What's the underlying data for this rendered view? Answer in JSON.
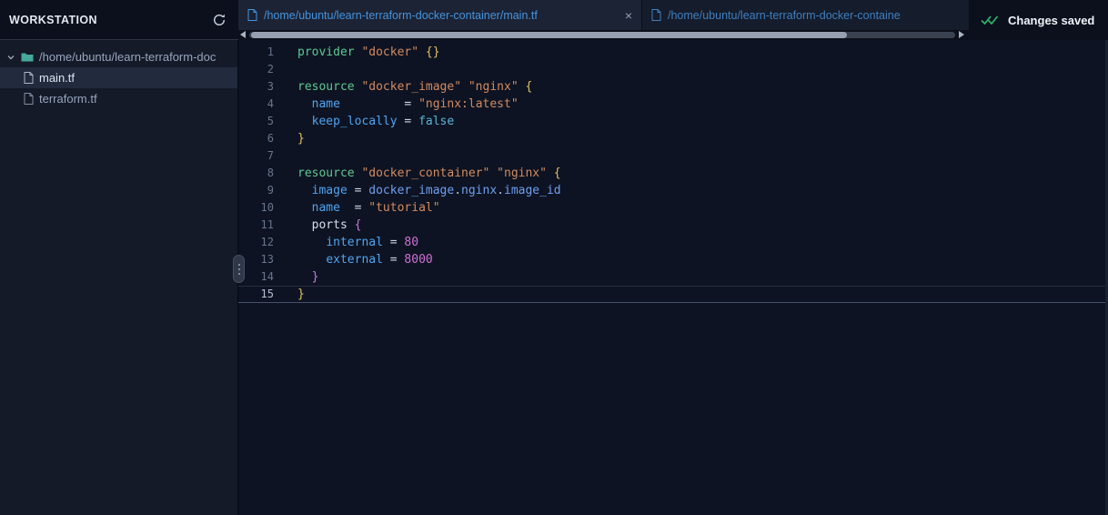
{
  "colors": {
    "topbar": "#0b101c",
    "sidebar": "#141a28",
    "editorBg": "#0d1322",
    "tabActive": "#1c2334",
    "tabTextActive": "#4593dd",
    "treeText": "#96a5bd",
    "success": "#2fb36b",
    "kw": "#5fc892",
    "str": "#d28a60",
    "brace": "#e2c06a",
    "prop": "#4fa4f2",
    "bool": "#59b6d8",
    "num": "#d06fd6",
    "pbrace": "#c678dd",
    "ref": "#6f9ff0"
  },
  "icons": {
    "refresh": "circular-arrow",
    "close": "×",
    "double_check": "✓✓",
    "chevron_down": "▾",
    "folder": "folder",
    "file": "document",
    "scroll_left": "◄",
    "scroll_right": "►"
  },
  "sidebar": {
    "title": "WORKSTATION",
    "items": [
      {
        "type": "folder",
        "label": "/home/ubuntu/learn-terraform-doc",
        "expanded": true,
        "selected": false
      },
      {
        "type": "file",
        "label": "main.tf",
        "selected": true
      },
      {
        "type": "file",
        "label": "terraform.tf",
        "selected": false
      }
    ]
  },
  "tabs": [
    {
      "label": "/home/ubuntu/learn-terraform-docker-container/main.tf",
      "active": true,
      "closable": true
    },
    {
      "label": "/home/ubuntu/learn-terraform-docker-containe",
      "active": false,
      "closable": false
    }
  ],
  "status": {
    "label": "Changes saved"
  },
  "editor": {
    "line_count": 15,
    "current_line": 15,
    "lines": [
      [
        [
          "kw",
          "provider"
        ],
        [
          "pl",
          " "
        ],
        [
          "str",
          "\"docker\""
        ],
        [
          "pl",
          " "
        ],
        [
          "brace",
          "{}"
        ]
      ],
      [],
      [
        [
          "kw",
          "resource"
        ],
        [
          "pl",
          " "
        ],
        [
          "str",
          "\"docker_image\""
        ],
        [
          "pl",
          " "
        ],
        [
          "str",
          "\"nginx\""
        ],
        [
          "pl",
          " "
        ],
        [
          "brace",
          "{"
        ]
      ],
      [
        [
          "pl",
          "  "
        ],
        [
          "prop",
          "name"
        ],
        [
          "pl",
          "         "
        ],
        [
          "op",
          "="
        ],
        [
          "pl",
          " "
        ],
        [
          "str",
          "\"nginx:latest\""
        ]
      ],
      [
        [
          "pl",
          "  "
        ],
        [
          "prop",
          "keep_locally"
        ],
        [
          "pl",
          " "
        ],
        [
          "op",
          "="
        ],
        [
          "pl",
          " "
        ],
        [
          "bool",
          "false"
        ]
      ],
      [
        [
          "brace",
          "}"
        ]
      ],
      [],
      [
        [
          "kw",
          "resource"
        ],
        [
          "pl",
          " "
        ],
        [
          "str",
          "\"docker_container\""
        ],
        [
          "pl",
          " "
        ],
        [
          "str",
          "\"nginx\""
        ],
        [
          "pl",
          " "
        ],
        [
          "brace",
          "{"
        ]
      ],
      [
        [
          "pl",
          "  "
        ],
        [
          "prop",
          "image"
        ],
        [
          "pl",
          " "
        ],
        [
          "op",
          "="
        ],
        [
          "pl",
          " "
        ],
        [
          "ref",
          "docker_image"
        ],
        [
          "dot",
          "."
        ],
        [
          "ref",
          "nginx"
        ],
        [
          "dot",
          "."
        ],
        [
          "ref",
          "image_id"
        ]
      ],
      [
        [
          "pl",
          "  "
        ],
        [
          "prop",
          "name"
        ],
        [
          "pl",
          "  "
        ],
        [
          "op",
          "="
        ],
        [
          "pl",
          " "
        ],
        [
          "str",
          "\"tutorial\""
        ]
      ],
      [
        [
          "pl",
          "  "
        ],
        [
          "pl2",
          "ports"
        ],
        [
          "pl",
          " "
        ],
        [
          "pbrace",
          "{"
        ]
      ],
      [
        [
          "pl",
          "    "
        ],
        [
          "prop",
          "internal"
        ],
        [
          "pl",
          " "
        ],
        [
          "op",
          "="
        ],
        [
          "pl",
          " "
        ],
        [
          "num",
          "80"
        ]
      ],
      [
        [
          "pl",
          "    "
        ],
        [
          "prop",
          "external"
        ],
        [
          "pl",
          " "
        ],
        [
          "op",
          "="
        ],
        [
          "pl",
          " "
        ],
        [
          "num",
          "8000"
        ]
      ],
      [
        [
          "pl",
          "  "
        ],
        [
          "pbrace",
          "}"
        ]
      ],
      [
        [
          "brace",
          "}"
        ]
      ]
    ]
  }
}
